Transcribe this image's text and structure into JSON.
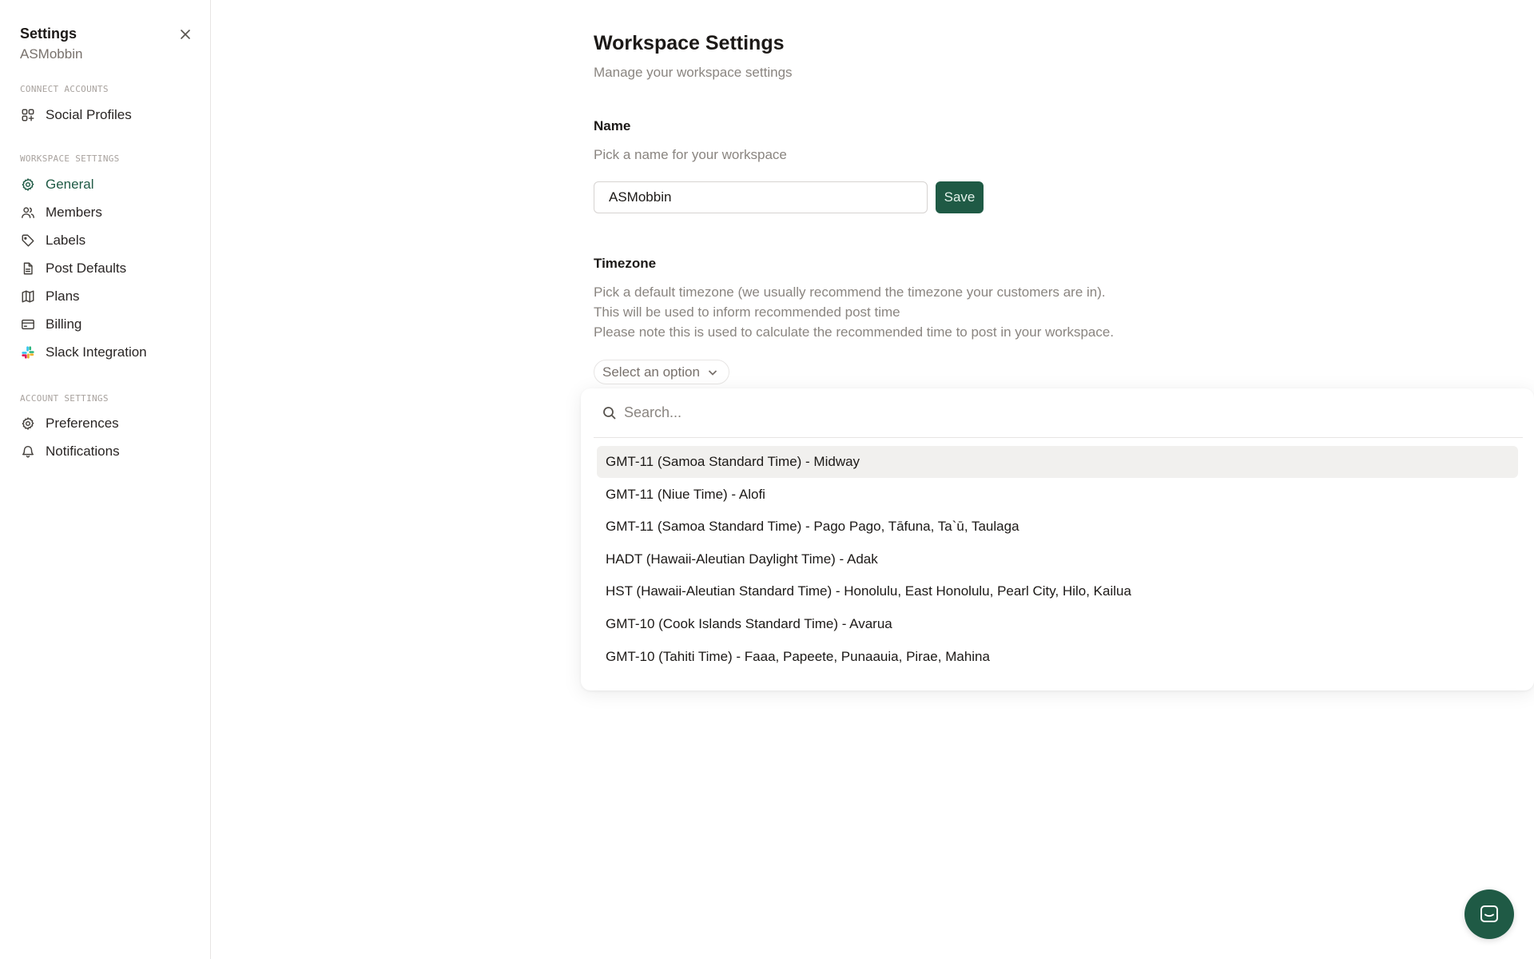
{
  "sidebar": {
    "title": "Settings",
    "workspace_name": "ASMobbin",
    "sections": {
      "connect": "Connect Accounts",
      "workspace": "Workspace Settings",
      "account": "Account Settings"
    },
    "items": {
      "social_profiles": "Social Profiles",
      "general": "General",
      "members": "Members",
      "labels": "Labels",
      "post_defaults": "Post Defaults",
      "plans": "Plans",
      "billing": "Billing",
      "slack": "Slack Integration",
      "preferences": "Preferences",
      "notifications": "Notifications"
    },
    "active_item": "General"
  },
  "main": {
    "title": "Workspace Settings",
    "subtitle": "Manage your workspace settings",
    "name": {
      "label": "Name",
      "description": "Pick a name for your workspace",
      "value": "ASMobbin",
      "save_label": "Save"
    },
    "timezone": {
      "label": "Timezone",
      "description_lines": [
        "Pick a default timezone (we usually recommend the timezone your customers are in).",
        "This will be used to inform recommended post time",
        "Please note this is used to calculate the recommended time to post in your workspace."
      ],
      "select_placeholder": "Select an option",
      "search_placeholder": "Search...",
      "options": [
        "GMT-11 (Samoa Standard Time) - Midway",
        "GMT-11 (Niue Time) - Alofi",
        "GMT-11 (Samoa Standard Time) - Pago Pago, Tāfuna, Ta`ū, Taulaga",
        "HADT (Hawaii-Aleutian Daylight Time) - Adak",
        "HST (Hawaii-Aleutian Standard Time) - Honolulu, East Honolulu, Pearl City, Hilo, Kailua",
        "GMT-10 (Cook Islands Standard Time) - Avarua",
        "GMT-10 (Tahiti Time) - Faaa, Papeete, Punaauia, Pirae, Mahina"
      ],
      "highlighted_option": "GMT-11 (Samoa Standard Time) - Midway"
    }
  },
  "colors": {
    "accent": "#1f5a45",
    "muted_text": "#8a8580",
    "border": "#e7e5e4",
    "highlight_bg": "#f1f0ee"
  }
}
